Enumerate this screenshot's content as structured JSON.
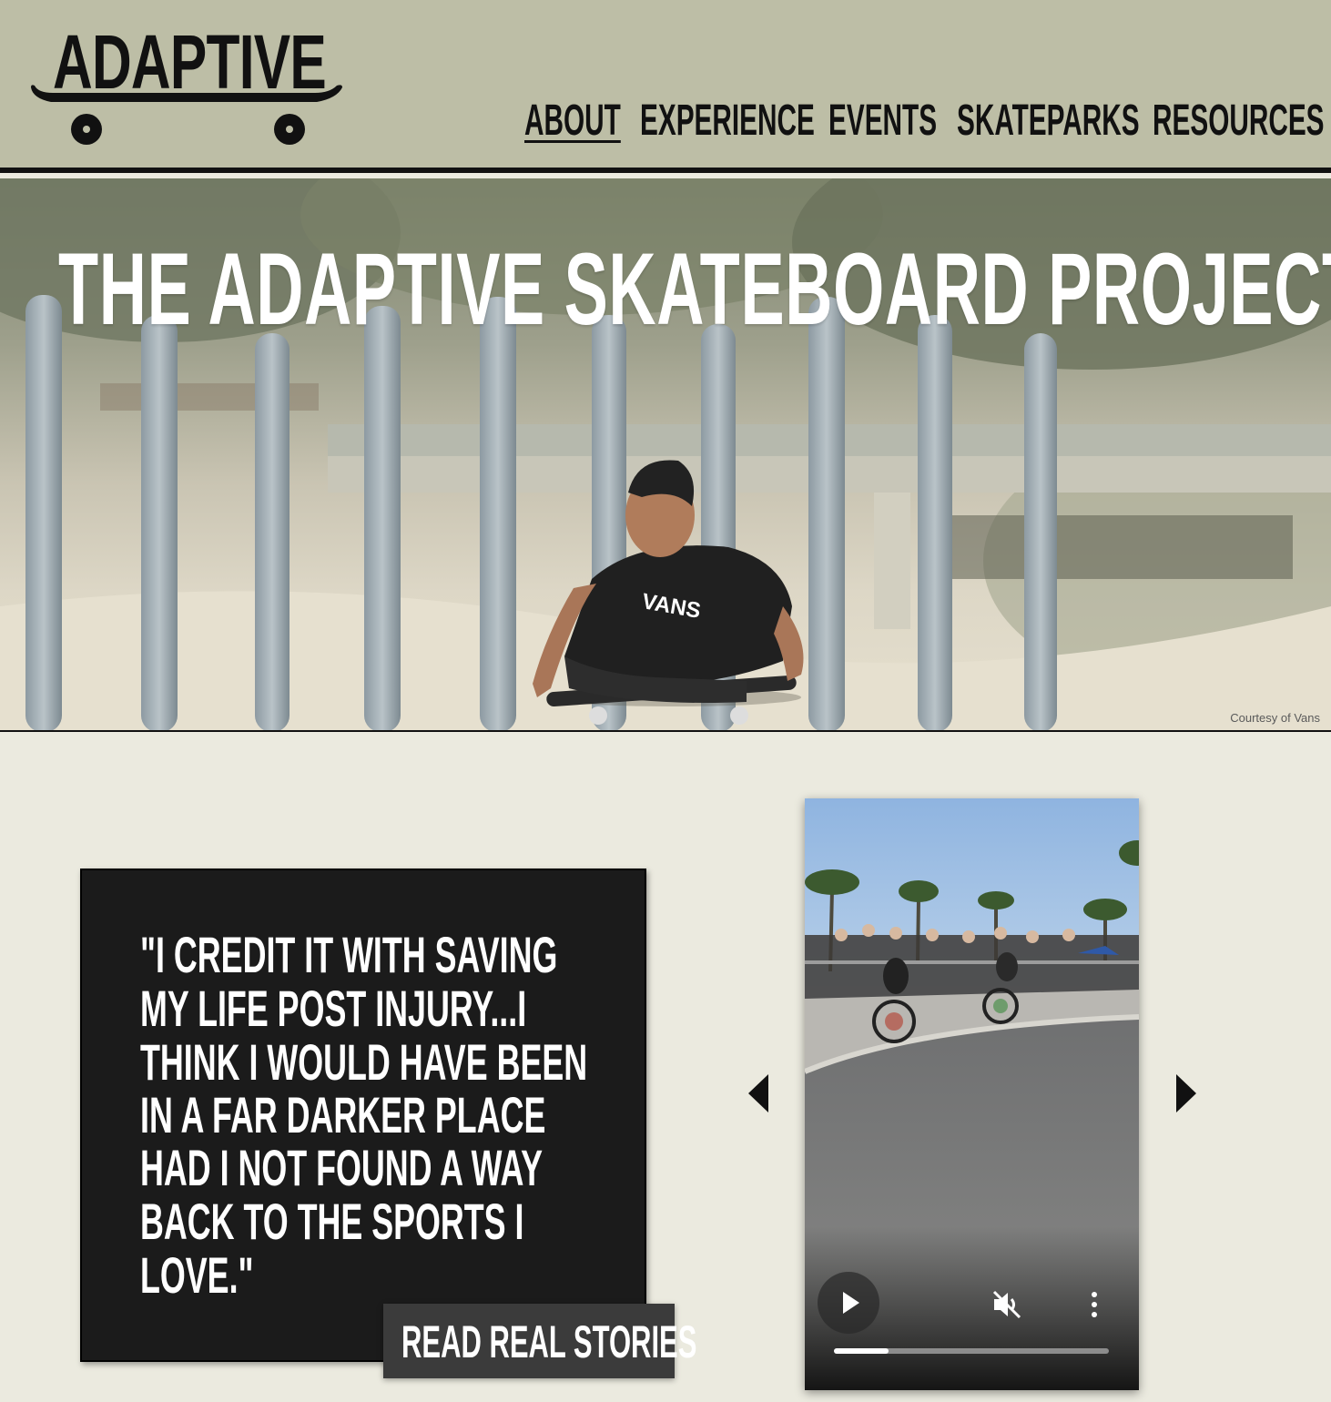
{
  "logo": {
    "text": "ADAPTIVE",
    "icon": "skateboard-icon"
  },
  "nav": {
    "items": [
      {
        "label": "ABOUT",
        "active": true
      },
      {
        "label": "EXPERIENCE",
        "active": false
      },
      {
        "label": "EVENTS",
        "active": false
      },
      {
        "label": "SKATEPARKS",
        "active": false
      },
      {
        "label": "RESOURCES",
        "active": false
      }
    ]
  },
  "hero": {
    "title": "THE ADAPTIVE SKATEBOARD PROJECT",
    "credit": "Courtesy of Vans",
    "shirt_text": "VANS"
  },
  "quote": {
    "lines": [
      "\"I CREDIT IT WITH SAVING",
      "MY LIFE POST INJURY...I",
      "THINK I WOULD HAVE BEEN",
      "IN A FAR DARKER PLACE",
      "HAD I NOT FOUND A WAY",
      "BACK TO THE SPORTS I",
      "LOVE.\""
    ],
    "button_label": "READ REAL STORIES"
  },
  "carousel": {
    "prev_icon": "arrow-left-icon",
    "next_icon": "arrow-right-icon",
    "video": {
      "play_icon": "play-icon",
      "mute_icon": "muted-speaker-icon",
      "menu_icon": "more-vertical-icon",
      "progress": 0.2
    }
  },
  "colors": {
    "header_bg": "#bdbea6",
    "page_bg": "#ebeadf",
    "card_bg": "#1b1b1b",
    "button_bg": "#3b3b3b"
  }
}
